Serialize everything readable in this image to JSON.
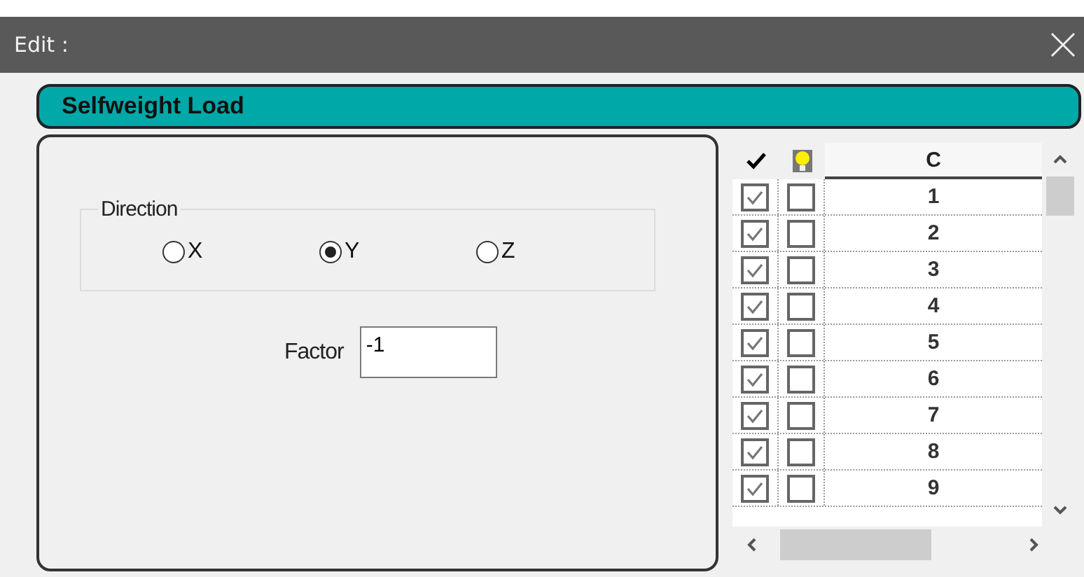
{
  "window": {
    "title": "Edit :"
  },
  "header": {
    "title": "Selfweight Load"
  },
  "direction": {
    "legend": "Direction",
    "options": [
      {
        "label": "X",
        "selected": false
      },
      {
        "label": "Y",
        "selected": true
      },
      {
        "label": "Z",
        "selected": false
      }
    ]
  },
  "factor": {
    "label": "Factor",
    "value": "-1"
  },
  "grid": {
    "column_header": "C",
    "rows": [
      {
        "checked": true,
        "flagged": false,
        "label": "1"
      },
      {
        "checked": true,
        "flagged": false,
        "label": "2"
      },
      {
        "checked": true,
        "flagged": false,
        "label": "3"
      },
      {
        "checked": true,
        "flagged": false,
        "label": "4"
      },
      {
        "checked": true,
        "flagged": false,
        "label": "5"
      },
      {
        "checked": true,
        "flagged": false,
        "label": "6"
      },
      {
        "checked": true,
        "flagged": false,
        "label": "7"
      },
      {
        "checked": true,
        "flagged": false,
        "label": "8"
      },
      {
        "checked": true,
        "flagged": false,
        "label": "9"
      }
    ]
  }
}
